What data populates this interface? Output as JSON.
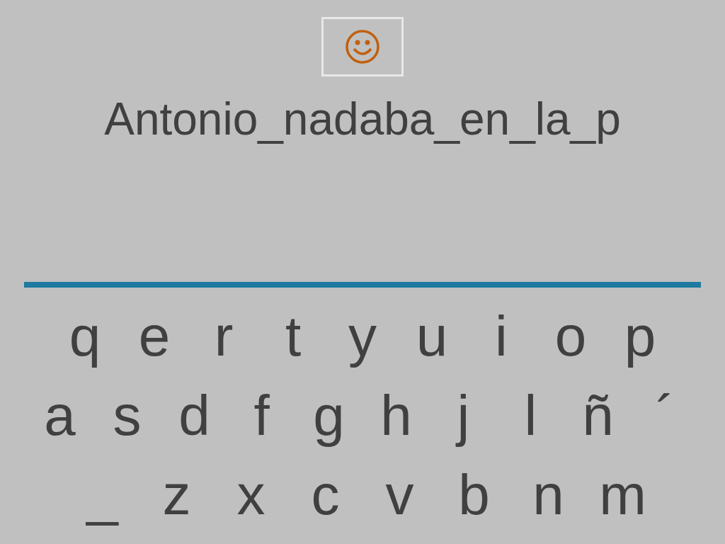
{
  "phrase": "Antonio_nadaba_en_la_p",
  "keyboard": [
    {
      "keys": [
        "q",
        "e",
        "r",
        "t",
        "y",
        "u",
        "i",
        "o",
        "p"
      ]
    },
    {
      "keys": [
        "a",
        "s",
        "d",
        "f",
        "g",
        "h",
        "j",
        "l",
        "ñ",
        "´"
      ]
    },
    {
      "keys": [
        "_",
        "z",
        "x",
        "c",
        "v",
        "b",
        "n",
        "m"
      ]
    }
  ]
}
